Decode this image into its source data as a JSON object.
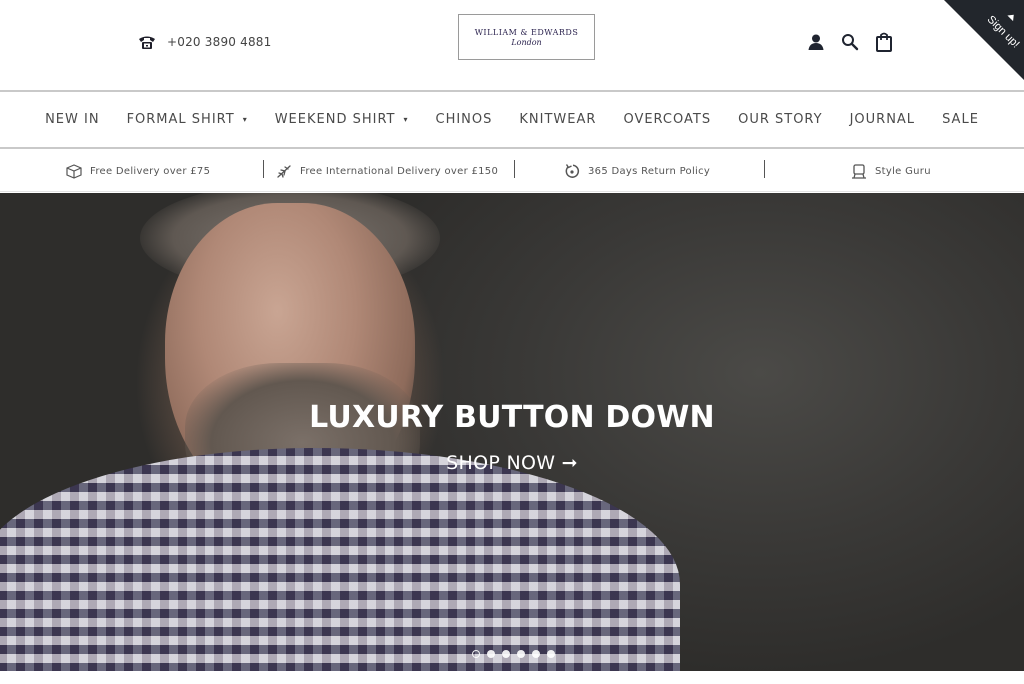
{
  "header": {
    "phone": "+020 3890 4881",
    "logo_line1": "WILLIAM & EDWARDS",
    "logo_line2": "London",
    "signup_label": "Sign up!"
  },
  "icons": {
    "phone": "phone-icon",
    "account": "user-icon",
    "search": "search-icon",
    "bag": "bag-icon"
  },
  "nav": {
    "items": [
      {
        "label": "NEW IN"
      },
      {
        "label": "FORMAL SHIRT"
      },
      {
        "label": "WEEKEND SHIRT"
      },
      {
        "label": "CHINOS"
      },
      {
        "label": "KNITWEAR"
      },
      {
        "label": "OVERCOATS"
      },
      {
        "label": "OUR STORY"
      },
      {
        "label": "JOURNAL"
      },
      {
        "label": "SALE"
      }
    ],
    "caret": "▾"
  },
  "perks": [
    {
      "label": "Free Delivery over £75",
      "icon": "box-icon"
    },
    {
      "label": "Free International Delivery over £150",
      "icon": "plane-icon"
    },
    {
      "label": "365 Days Return Policy",
      "icon": "return-icon"
    },
    {
      "label": "Style Guru",
      "icon": "guru-icon"
    }
  ],
  "hero": {
    "title": "LUXURY BUTTON DOWN",
    "cta": "SHOP NOW ➞",
    "slide_count": 6,
    "active_slide": 1
  },
  "colors": {
    "brand": "#2d2550",
    "nav_text": "#4a4a4a",
    "signup_bg": "#22262c"
  }
}
